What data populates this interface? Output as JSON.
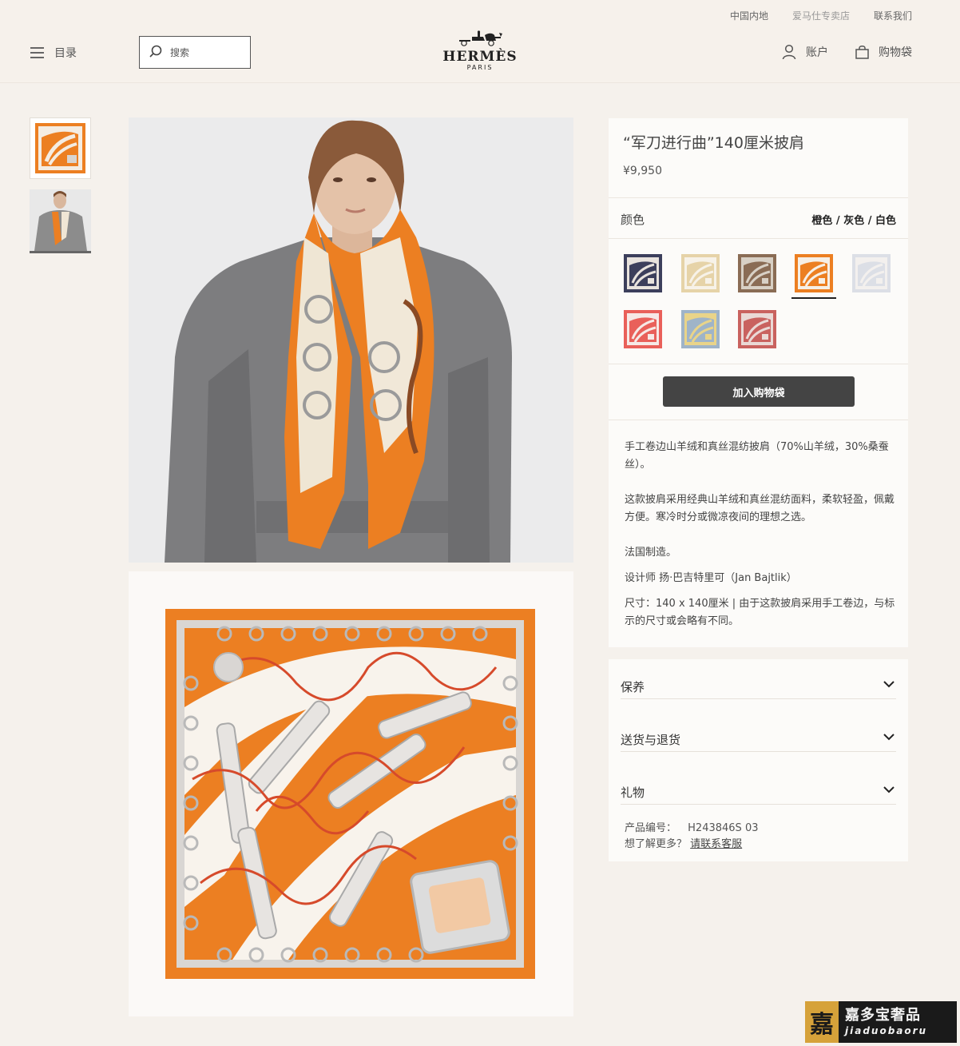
{
  "header": {
    "top_links": [
      "中国内地",
      "爱马仕专卖店",
      "联系我们"
    ],
    "menu_label": "目录",
    "search_placeholder": "搜索",
    "logo_name": "HERMÈS",
    "logo_city": "PARIS",
    "account_label": "账户",
    "bag_label": "购物袋"
  },
  "product": {
    "title": "“军刀进行曲”140厘米披肩",
    "price": "¥9,950",
    "color_label": "颜色",
    "color_value": "橙色 / 灰色 / 白色",
    "swatches": [
      {
        "name": "navy-brown",
        "primary": "#3c3f5c",
        "accent": "#e8e3de",
        "selected": false
      },
      {
        "name": "beige",
        "primary": "#e6d3a8",
        "accent": "#f7f2e8",
        "selected": false
      },
      {
        "name": "brown-grey",
        "primary": "#8a6c55",
        "accent": "#d8d0c5",
        "selected": false
      },
      {
        "name": "orange-grey-white",
        "primary": "#ec7f22",
        "accent": "#f6efe6",
        "selected": true
      },
      {
        "name": "light-grey-blue",
        "primary": "#dcdfe6",
        "accent": "#f3f0ee",
        "selected": false
      },
      {
        "name": "coral-red",
        "primary": "#e9605a",
        "accent": "#f6e9e6",
        "selected": false
      },
      {
        "name": "blue-yellow",
        "primary": "#9fb4c8",
        "accent": "#e9d489",
        "selected": false
      },
      {
        "name": "rose-red",
        "primary": "#c9625f",
        "accent": "#ead9d6",
        "selected": false
      }
    ],
    "add_to_bag": "加入购物袋",
    "description": [
      "手工卷边山羊绒和真丝混纺披肩（70%山羊绒，30%桑蚕丝）。",
      "这款披肩采用经典山羊绒和真丝混纺面料，柔软轻盈，佩戴方便。寒冷时分或微凉夜间的理想之选。",
      "法国制造。",
      "设计师 扬·巴吉特里可（Jan Bajtlik）",
      "尺寸：140 x 140厘米 | 由于这款披肩采用手工卷边，与标示的尺寸或会略有不同。"
    ]
  },
  "accordion": {
    "items": [
      "保养",
      "送货与退货",
      "礼物"
    ],
    "ref_label": "产品编号：",
    "ref_value": "H243846S 03",
    "more_label": "想了解更多？",
    "contact_link": "请联系客服"
  },
  "watermark": {
    "seal": "嘉",
    "cn": "嘉多宝奢品",
    "en": "jiaduobaoru"
  },
  "colors": {
    "scarf_orange": "#ec7f22",
    "button_bg": "#444444",
    "page_bg": "#f5f1ec"
  }
}
